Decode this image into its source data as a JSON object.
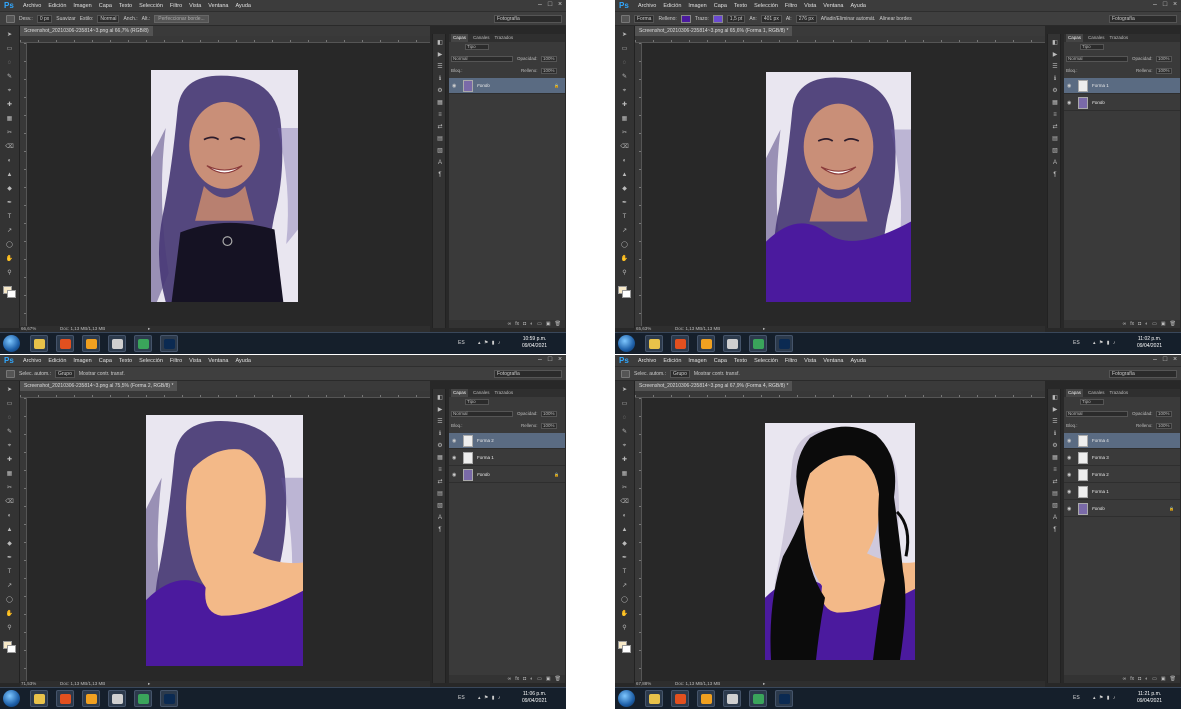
{
  "menu": [
    "Archivo",
    "Edición",
    "Imagen",
    "Capa",
    "Texto",
    "Selección",
    "Filtro",
    "Vista",
    "Ventana",
    "Ayuda"
  ],
  "app_logo": "Ps",
  "workspace": "Fotografía",
  "panel": {
    "tabs": [
      "Capas",
      "Canales",
      "Trazados"
    ],
    "search": "Tipo",
    "blend_mode": "Normal",
    "opacity_label": "Opacidad:",
    "opacity_value": "100%",
    "lock_label": "Bloq.:",
    "fill_label": "Relleno:",
    "fill_value": "100%"
  },
  "taskbar": {
    "lang": "ES"
  },
  "screens": [
    {
      "options": {
        "a": "Desv.:",
        "b": "0 px",
        "c": "Suavizar",
        "d": "Estilo:",
        "e": "Normal",
        "f": "Anch.:",
        "g": "Alt.:",
        "h": "Perfeccionar borde..."
      },
      "doc_tab": "Screenshot_20210306-235814~3.png al 66,7% (RGB/8)",
      "zoom": "66,67%",
      "doc_size": "Doc: 1,13 MB/1,13 MB",
      "time": "10:59 p.m.",
      "date": "09/04/2021",
      "layers": [
        {
          "name": "Fondo",
          "italic": true,
          "locked": true,
          "selected": true
        }
      ]
    },
    {
      "options": {
        "a": "Forma",
        "b": "Relleno:",
        "c": "Trazo:",
        "d": "1,5 pt",
        "e": "An:",
        "f": "401 px",
        "g": "Al:",
        "h": "276 px",
        "i": "Añadir/Eliminar automát.",
        "j": "Alinear bordes"
      },
      "doc_tab": "Screenshot_20210306-235814~3.png al 65,6% (Forma 1, RGB/8) *",
      "zoom": "65,63%",
      "doc_size": "Doc: 1,13 MB/1,13 MB",
      "time": "11:02 p.m.",
      "date": "09/04/2021",
      "layers": [
        {
          "name": "Forma 1",
          "italic": false,
          "locked": false,
          "selected": true
        },
        {
          "name": "Fondo",
          "italic": true,
          "locked": false,
          "selected": false
        }
      ]
    },
    {
      "options": {
        "a": "Selec. autom.:",
        "b": "Grupo",
        "c": "Mostrar contr. transf."
      },
      "doc_tab": "Screenshot_20210306-235814~3.png al 75,5% (Forma 2, RGB/8) *",
      "zoom": "71,53%",
      "doc_size": "Doc: 1,13 MB/1,13 MB",
      "time": "11:06 p.m.",
      "date": "09/04/2021",
      "layers": [
        {
          "name": "Forma 2",
          "italic": false,
          "locked": false,
          "selected": true
        },
        {
          "name": "Forma 1",
          "italic": false,
          "locked": false,
          "selected": false
        },
        {
          "name": "Fondo",
          "italic": true,
          "locked": true,
          "selected": false
        }
      ]
    },
    {
      "options": {
        "a": "Selec. autom.:",
        "b": "Grupo",
        "c": "Mostrar contr. transf."
      },
      "doc_tab": "Screenshot_20210306-235814~3.png al 67,9% (Forma 4, RGB/8) *",
      "zoom": "67,88%",
      "doc_size": "Doc: 1,13 MB/1,13 MB",
      "time": "11:21 p.m.",
      "date": "09/04/2021",
      "layers": [
        {
          "name": "Forma 4",
          "italic": false,
          "locked": false,
          "selected": true
        },
        {
          "name": "Forma 3",
          "italic": false,
          "locked": false,
          "selected": false
        },
        {
          "name": "Forma 2",
          "italic": false,
          "locked": false,
          "selected": false
        },
        {
          "name": "Forma 1",
          "italic": false,
          "locked": false,
          "selected": false
        },
        {
          "name": "Fondo",
          "italic": true,
          "locked": true,
          "selected": false
        }
      ]
    }
  ],
  "colors": {
    "skin": "#f3b988",
    "shirt": "#4b1a9e",
    "hair": "#0b0b0b",
    "photo_bg": "#e9e6f0"
  }
}
